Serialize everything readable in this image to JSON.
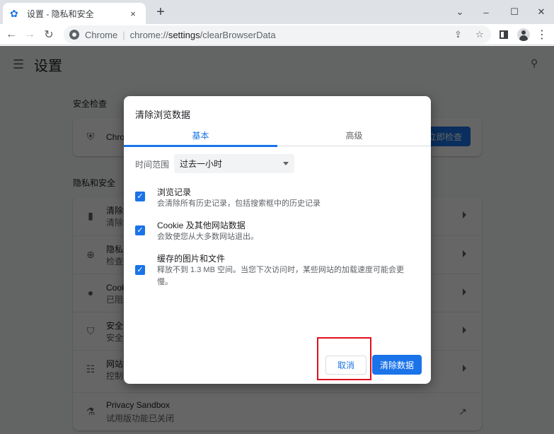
{
  "browser": {
    "tab_title": "设置 - 隐私和安全",
    "tab_close": "×",
    "new_tab": "+",
    "window_controls": {
      "dropdown": "⌄",
      "minimize": "–",
      "maximize": "☐",
      "close": "✕"
    },
    "nav": {
      "back": "←",
      "forward": "→",
      "reload": "↻"
    },
    "omnibox": {
      "site_name": "Chrome",
      "separator": "|",
      "url_prefix": "chrome://",
      "url_host": "settings",
      "url_path": "/clearBrowserData"
    },
    "share_icon": "⇪",
    "bookmark_icon": "☆",
    "menu_icon": "⋮"
  },
  "settings": {
    "menu_icon": "☰",
    "title": "设置",
    "search_icon": "🔍",
    "safety_check": {
      "section_label": "安全检查",
      "row_text": "Chrome",
      "check_button": "立即检查"
    },
    "privacy": {
      "section_label": "隐私和安全",
      "rows": [
        {
          "icon": "trash-icon",
          "title": "清除浏览数据",
          "subtitle": "清除浏览记录"
        },
        {
          "icon": "privacy-guide-icon",
          "title": "隐私设置指南",
          "subtitle": "检查重要的隐私和安全控制项"
        },
        {
          "icon": "cookie-icon",
          "title": "Cookie 及其他网站数据",
          "subtitle": "已阻止无痕模式下的第三方 Cookie"
        },
        {
          "icon": "security-shield-icon",
          "title": "安全",
          "subtitle": "安全浏览"
        },
        {
          "icon": "site-settings-icon",
          "title": "网站设置",
          "subtitle": "控制网站可以使用和显示什么信息"
        }
      ],
      "sandbox": {
        "title": "Privacy Sandbox",
        "subtitle": "试用版功能已关闭"
      }
    }
  },
  "dialog": {
    "title": "清除浏览数据",
    "tabs": [
      {
        "label": "基本",
        "active": true
      },
      {
        "label": "高级",
        "active": false
      }
    ],
    "time_range": {
      "label": "时间范围",
      "value": "过去一小时"
    },
    "options": [
      {
        "checked": true,
        "title": "浏览记录",
        "description": "会清除所有历史记录，包括搜索框中的历史记录"
      },
      {
        "checked": true,
        "title": "Cookie 及其他网站数据",
        "description": "会致使您从大多数网站退出。"
      },
      {
        "checked": true,
        "title": "缓存的图片和文件",
        "description": "释放不到 1.3 MB 空间。当您下次访问时，某些网站的加载速度可能会更慢。"
      }
    ],
    "cancel_label": "取消",
    "clear_label": "清除数据",
    "checkmark": "✓"
  },
  "colors": {
    "accent": "#1a73e8",
    "highlight": "#e0101c"
  }
}
